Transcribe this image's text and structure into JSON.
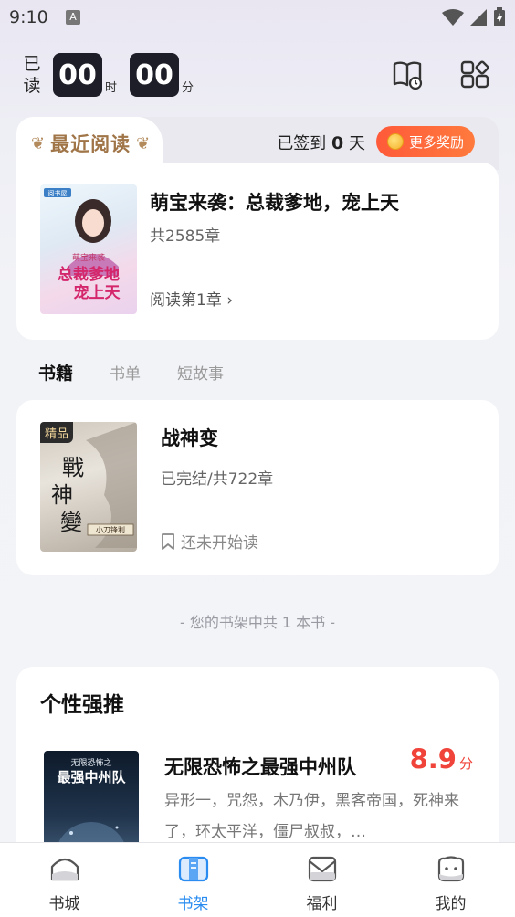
{
  "status_bar": {
    "time": "9:10",
    "notif_badge": "A"
  },
  "timer": {
    "label_line1": "已",
    "label_line2": "读",
    "hours": "00",
    "hours_unit": "时",
    "minutes": "00",
    "minutes_unit": "分"
  },
  "header_icons": [
    "history-book-icon",
    "category-grid-icon"
  ],
  "recent": {
    "section_title": "最近阅读",
    "signin_prefix": "已签到",
    "signin_days": "0",
    "signin_suffix": "天",
    "reward_button": "更多奖励",
    "book": {
      "title": "萌宝来袭：总裁爹地，宠上天",
      "chapters": "共2585章",
      "progress": "阅读第1章",
      "cover_title": "总裁爹地宠上天",
      "cover_subtitle": "萌宝来袭",
      "cover_brand": "阅书屋"
    }
  },
  "tabs": [
    {
      "label": "书籍",
      "active": true
    },
    {
      "label": "书单",
      "active": false
    },
    {
      "label": "短故事",
      "active": false
    }
  ],
  "bookshelf": {
    "book": {
      "badge": "精品",
      "title": "战神变",
      "status": "已完结/共722章",
      "read_state": "还未开始读",
      "cover_title": "戰神變",
      "cover_author": "小刀锋利"
    },
    "count_text": "- 您的书架中共 1 本书 -"
  },
  "recommend": {
    "section_title": "个性强推",
    "book": {
      "title": "无限恐怖之最强中州队",
      "score": "8.9",
      "score_unit": "分",
      "description": "异形一，咒怨，木乃伊，黑客帝国，死神来了，环太平洋，僵尸叔叔，…",
      "cover_line1": "无限恐怖之",
      "cover_line2": "最强中州队"
    }
  },
  "bottom_nav": [
    {
      "label": "书城",
      "icon": "bookstore-icon",
      "active": false
    },
    {
      "label": "书架",
      "icon": "bookshelf-icon",
      "active": true
    },
    {
      "label": "福利",
      "icon": "welfare-icon",
      "active": false
    },
    {
      "label": "我的",
      "icon": "profile-icon",
      "active": false
    }
  ],
  "colors": {
    "accent_blue": "#2a8cf0",
    "reward_orange": "#ff5a3a",
    "score_red": "#f0443b",
    "section_gold": "#a07548"
  }
}
